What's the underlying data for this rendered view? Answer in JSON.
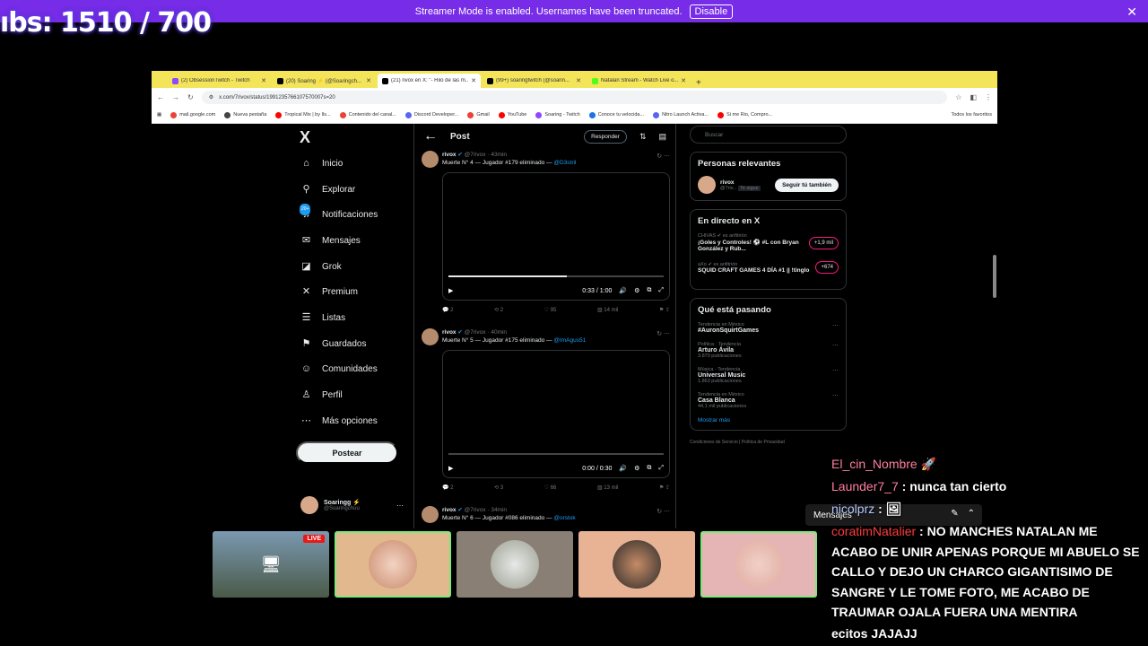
{
  "banner": {
    "text": "Streamer Mode is enabled. Usernames have been truncated.",
    "disable": "Disable",
    "close": "✕"
  },
  "overlay": {
    "subs": "ıbs: 1510 / 700"
  },
  "browser": {
    "tabs": [
      {
        "title": "(2) ObsessionTwitch - Twitch",
        "color": "#9146ff"
      },
      {
        "title": "(20) Soaring ⚡ (@Soaringch...",
        "color": "#000"
      },
      {
        "title": "(21) rivox en X: \"- Hilo de las m...",
        "color": "#000"
      },
      {
        "title": "(99+) soaringtwitch (@soarin...",
        "color": "#000"
      },
      {
        "title": "Natalan Stream - Watch Live o...",
        "color": "#53fc18"
      }
    ],
    "url": "x.com/7rivox/status/1991235766107570007s=20",
    "bookmarks": [
      "mail.google.com",
      "Nueva pestaña",
      "Tropical Mix | by Ils...",
      "Contenido del canal...",
      "Discord Developer...",
      "Gmail",
      "YouTube",
      "Soaring - Twitch",
      "Conoce tu velocida...",
      "Nitro Launch Activa...",
      "Si me Rio, Compro..."
    ],
    "bookmarks_all": "Todos los favoritos"
  },
  "nav": {
    "logo": "X",
    "items": [
      {
        "label": "Inicio",
        "icon": "home-icon",
        "glyph": "⌂"
      },
      {
        "label": "Explorar",
        "icon": "search-icon",
        "glyph": "⚲"
      },
      {
        "label": "Notificaciones",
        "icon": "bell-icon",
        "glyph": "♫",
        "badge": "20+"
      },
      {
        "label": "Mensajes",
        "icon": "mail-icon",
        "glyph": "✉"
      },
      {
        "label": "Grok",
        "icon": "grok-icon",
        "glyph": "◪"
      },
      {
        "label": "Premium",
        "icon": "x-icon",
        "glyph": "✕"
      },
      {
        "label": "Listas",
        "icon": "list-icon",
        "glyph": "☰"
      },
      {
        "label": "Guardados",
        "icon": "bookmark-icon",
        "glyph": "⚑"
      },
      {
        "label": "Comunidades",
        "icon": "people-icon",
        "glyph": "☺"
      },
      {
        "label": "Perfil",
        "icon": "person-icon",
        "glyph": "♙"
      },
      {
        "label": "Más opciones",
        "icon": "more-icon",
        "glyph": "⋯"
      }
    ],
    "post": "Postear",
    "profile": {
      "name": "Soaringg ⚡",
      "handle": "@Soaringchuu"
    }
  },
  "main": {
    "back": "←",
    "title": "Post",
    "reply": "Responder",
    "tweets": [
      {
        "name": "rivox",
        "handle": "@7rivox · 43min",
        "text": "Muerte N° 4 — Jugador #179 eliminado — ",
        "mention": "@D3stril",
        "time": "0:33 / 1:00",
        "progress": 0.55,
        "replies": "2",
        "rts": "2",
        "likes": "95",
        "views": "14 mil"
      },
      {
        "name": "rivox",
        "handle": "@7rivox · 40min",
        "text": "Muerte N° 5 — Jugador #175 eliminado — ",
        "mention": "@ImAgus51",
        "time": "0:00 / 0:30",
        "progress": 0,
        "replies": "2",
        "rts": "3",
        "likes": "66",
        "views": "13 mil"
      },
      {
        "name": "rivox",
        "handle": "@7rivox · 34min",
        "text": "Muerte N° 6 — Jugador #086 eliminado — ",
        "mention": "@orstok"
      }
    ]
  },
  "side": {
    "search": "Buscar",
    "relevant": {
      "title": "Personas relevantes",
      "name": "rivox",
      "handle": "@7riv...",
      "tag": "Te sigue",
      "follow": "Seguir tú también"
    },
    "live": {
      "title": "En directo en X",
      "items": [
        {
          "host": "CHIVAS ✔ es anfitrión",
          "title": "¡Goles y Controles! ⚽ #L con Bryan González y Rub...",
          "count": "+1,9 mil"
        },
        {
          "host": "aXo ✔ es anfitrión",
          "title": "SQUID CRAFT GAMES 4 DÍA #1 || !tinglo",
          "count": "+674"
        }
      ]
    },
    "trends": {
      "title": "Qué está pasando",
      "items": [
        {
          "cat": "Tendencia en México",
          "name": "#AuronSquirtGames",
          "posts": ""
        },
        {
          "cat": "Política · Tendencia",
          "name": "Arturo Ávila",
          "posts": "3.870 publicaciones"
        },
        {
          "cat": "Música · Tendencia",
          "name": "Universal Music",
          "posts": "1.863 publicaciones"
        },
        {
          "cat": "Tendencia en México",
          "name": "Casa Blanca",
          "posts": "44,1 mil publicaciones"
        }
      ],
      "more": "Mostrar más"
    },
    "footer": "Condiciones de Servicio | Política de Privacidad"
  },
  "chat": {
    "lines": [
      {
        "user": "El_cin_Nombre",
        "color": "#ff7f9f",
        "msg": " 🚀"
      },
      {
        "user": "Launder7_7",
        "color": "#ff7f9f",
        "msg": " : nunca tan cierto"
      },
      {
        "user": "nicolprz",
        "color": "#b6c9ff",
        "msg": " : 🖼"
      },
      {
        "user": "coratimNatalier",
        "color": "#ff3b3b",
        "msg": " : NO MANCHES NATALAN ME ACABO DE UNIR APENAS PORQUE MI ABUELO SE CALLO Y DEJO UN CHARCO GIGANTISIMO DE SANGRE Y LE TOME FOTO, ME ACABO DE TRAUMAR OJALA FUERA UNA MENTIRA"
      },
      {
        "user": "",
        "color": "#fff",
        "msg": "ecitos JAJAJJ"
      }
    ],
    "messages_label": "Mensajes"
  },
  "cams": {
    "live": "LIVE"
  }
}
